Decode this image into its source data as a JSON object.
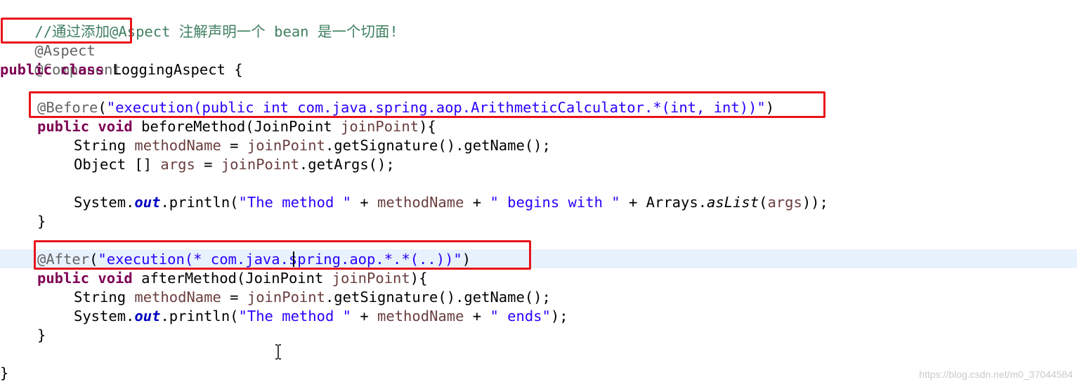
{
  "editor": {
    "highlight_colors": {
      "red_box": "#e8141b",
      "current_line": "#e8f2fe"
    },
    "lines": {
      "l1": {
        "comment": "//通过添加@Aspect 注解声明一个 bean 是一个切面!"
      },
      "l2": {
        "annotation": "@Aspect"
      },
      "l3": {
        "annotation": "@Component"
      },
      "l4": {
        "kw1": "public",
        "kw2": "class",
        "rest": " LoggingAspect {"
      },
      "l6": {
        "annotation": "@Before",
        "open": "(",
        "string": "\"execution(public int com.java.spring.aop.ArithmeticCalculator.*(int, int))\"",
        "close": ")"
      },
      "l7": {
        "kw1": "public",
        "kw2": "void",
        "method": " beforeMethod(JoinPoint ",
        "param": "joinPoint",
        "end": "){"
      },
      "l8": {
        "type": "String ",
        "var": "methodName",
        "eq": " = ",
        "obj": "joinPoint",
        "call": ".getSignature().getName();"
      },
      "l9": {
        "type": "Object [] ",
        "var": "args",
        "eq": " = ",
        "obj": "joinPoint",
        "call": ".getArgs();"
      },
      "l11": {
        "sys": "System.",
        "out": "out",
        "println": ".println(",
        "s1": "\"The method \"",
        "plus1": " + ",
        "var": "methodName",
        "plus2": " + ",
        "s2": "\" begins with \"",
        "plus3": " + Arrays.",
        "aslist": "asList",
        "open": "(",
        "arg": "args",
        "close": "));"
      },
      "l12": {
        "text": "}"
      },
      "l14": {
        "annotation": "@After",
        "open": "(",
        "string": "\"execution(* com.java.spring.aop.*.*(..))\"",
        "close": ")"
      },
      "l15": {
        "kw1": "public",
        "kw2": "void",
        "method": " afterMethod(JoinPoint ",
        "param": "joinPoint",
        "end": "){"
      },
      "l16": {
        "type": "String ",
        "var": "methodName",
        "eq": " = ",
        "obj": "joinPoint",
        "call": ".getSignature().getName();"
      },
      "l17": {
        "sys": "System.",
        "out": "out",
        "println": ".println(",
        "s1": "\"The method \"",
        "plus1": " + ",
        "var": "methodName",
        "plus2": " + ",
        "s2": "\" ends\"",
        "close": ");"
      },
      "l18": {
        "text": "}"
      },
      "l20": {
        "text": "}"
      }
    }
  },
  "watermark": "https://blog.csdn.net/m0_37044584"
}
